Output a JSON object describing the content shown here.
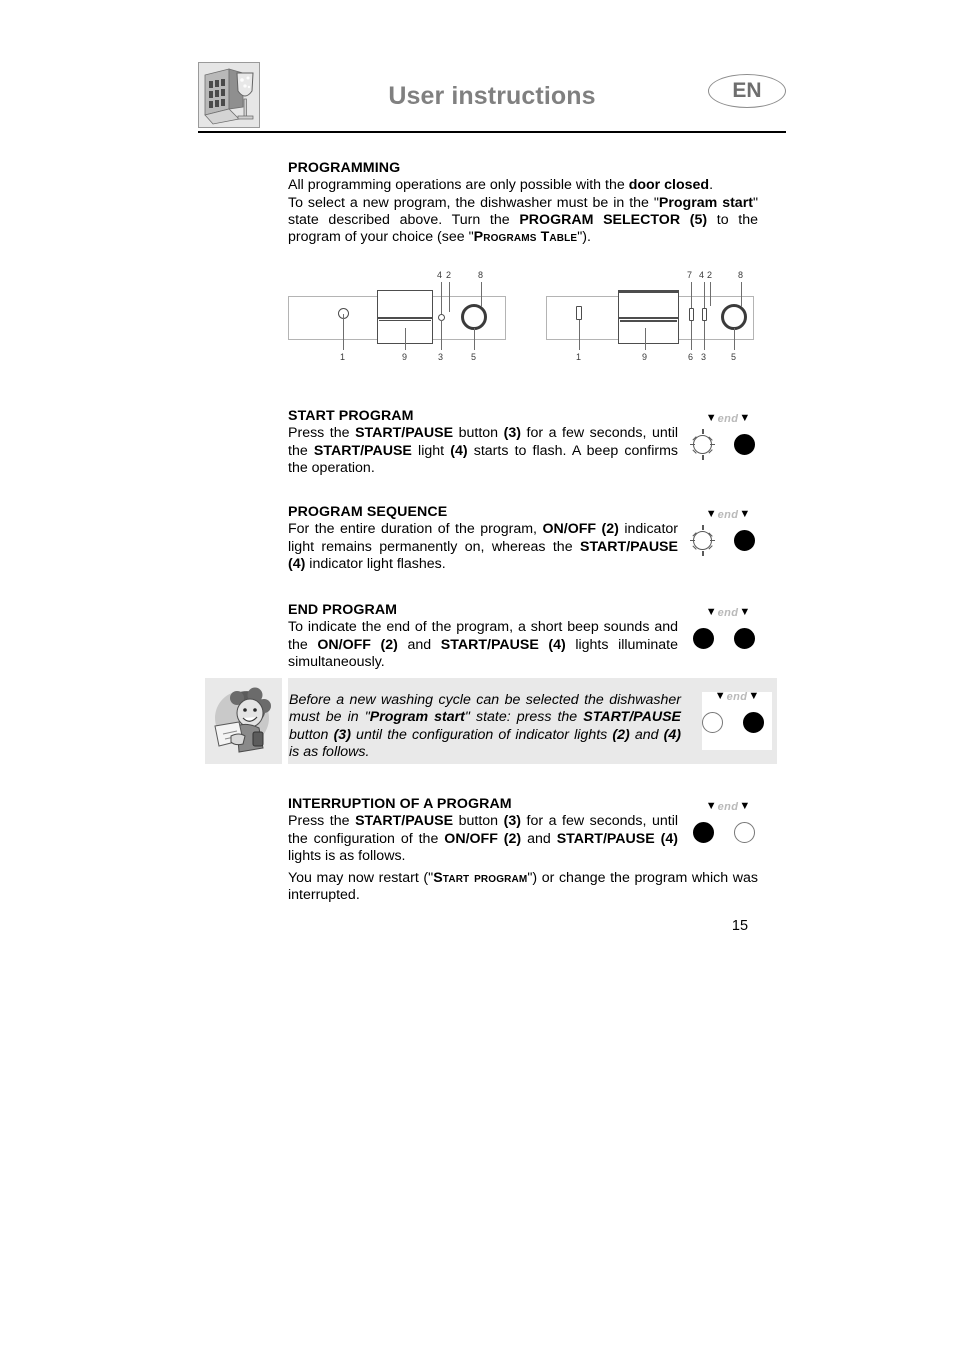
{
  "header": {
    "title": "User instructions",
    "language_badge": "EN",
    "icon": "dishwasher-glass-icon"
  },
  "sections": {
    "programming": {
      "heading": "PROGRAMMING",
      "line1_a": "All programming operations are only possible with the ",
      "line1_b": "door closed",
      "line1_c": ".",
      "line2_a": "To select a new program, the dishwasher must be in the \"",
      "line2_b": "Program start",
      "line2_c": "\" state described above. Turn the ",
      "line2_d": "PROGRAM SELECTOR (5)",
      "line2_e": " to the program of your choice (see \"",
      "line2_f": "Programs Table",
      "line2_g": "\")."
    },
    "start_program": {
      "heading": "START PROGRAM",
      "t1": "Press the ",
      "b1": "START/PAUSE",
      "t2": " button ",
      "b2": "(3)",
      "t3": " for a few seconds, until the ",
      "b3": "START/PAUSE",
      "t4": " light ",
      "b4": "(4)",
      "t5": " starts to flash. A beep confirms the operation."
    },
    "program_sequence": {
      "heading": "PROGRAM SEQUENCE",
      "t1": "For the entire duration of the program, ",
      "b1": "ON/OFF (2)",
      "t2": " indicator light remains permanently on, whereas the ",
      "b2": "START/PAUSE (4)",
      "t3": " indicator light flashes."
    },
    "end_program": {
      "heading": "END PROGRAM",
      "t1": "To indicate the end of the program, a short beep sounds and the ",
      "b1": "ON/OFF (2)",
      "t2": " and ",
      "b2": "START/PAUSE (4)",
      "t3": " lights illuminate simultaneously."
    },
    "note": {
      "icon": "person-tip-icon",
      "t1": "Before a new washing cycle can be selected the dishwasher must be in \"",
      "b1": "Program start",
      "t2": "\" state: press the ",
      "b2": "START/PAUSE",
      "t3": " button ",
      "b3": "(3)",
      "t4": " until the configuration of indicator lights ",
      "b4": "(2)",
      "t5": " and ",
      "b5": "(4)",
      "t6": " is as follows."
    },
    "interruption": {
      "heading": "INTERRUPTION OF A PROGRAM",
      "t1": "Press the ",
      "b1": "START/PAUSE",
      "t2": " button ",
      "b2": "(3)",
      "t3": " for a few seconds, until the configuration of the ",
      "b3": "ON/OFF (2)",
      "t4": " and ",
      "b4": "START/PAUSE (4)",
      "t5": " lights is as follows.",
      "p2_a": "You may now restart (\"",
      "p2_b": "Start program",
      "p2_c": "\") or change the program which was interrupted."
    }
  },
  "led_groups": {
    "end_label_left_triangle": "▼",
    "end_label_text": "end",
    "end_label_right_triangle": "▼",
    "start_program": {
      "left": "flashing",
      "right": "on"
    },
    "program_sequence": {
      "left": "flashing",
      "right": "on"
    },
    "end_program": {
      "left": "on",
      "right": "on"
    },
    "note": {
      "left": "off",
      "right": "on"
    },
    "interruption": {
      "left": "on",
      "right": "off"
    }
  },
  "diagrams": {
    "left_panel": {
      "name": "control-panel-diagram-model-a",
      "top_labels": [
        "4",
        "2",
        "8"
      ],
      "bottom_labels": [
        "1",
        "9",
        "3",
        "5"
      ]
    },
    "right_panel": {
      "name": "control-panel-diagram-model-b",
      "top_labels": [
        "7",
        "4",
        "2",
        "8"
      ],
      "bottom_labels": [
        "1",
        "9",
        "6",
        "3",
        "5"
      ]
    }
  },
  "footer": {
    "page_number": "15"
  },
  "colors": {
    "title_gray": "#808080",
    "note_background": "#e9e9e9",
    "led_on": "#000000",
    "led_off": "#ffffff"
  }
}
